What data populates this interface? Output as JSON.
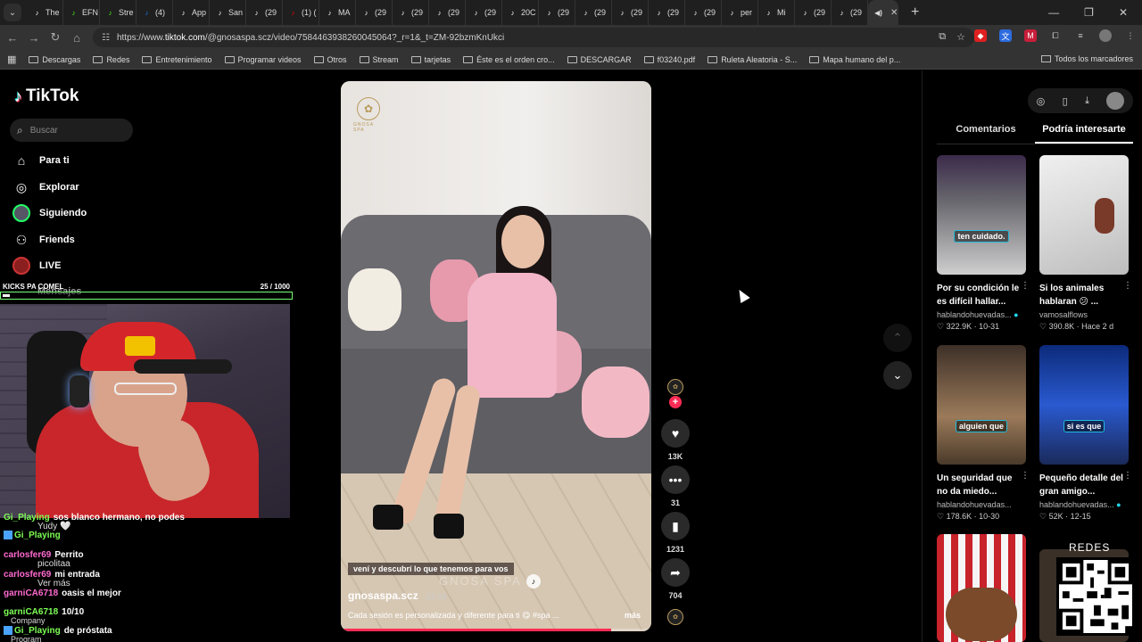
{
  "browser": {
    "tabs": [
      "The",
      "EFN",
      "Stre",
      "(4) ",
      "App",
      "San",
      "(29",
      "(1) (",
      "MA",
      "(29",
      "(29",
      "(29",
      "(29",
      "20C",
      "(29",
      "(29",
      "(29",
      "(29",
      "(29",
      "per",
      "Mi",
      "(29",
      "(29"
    ],
    "url_prefix": "https://www.",
    "url_host": "tiktok.com",
    "url_path": "/@gnosaspa.scz/video/7584463938260045064?_r=1&_t=ZM-92bzmKnUkci",
    "bookmarks": [
      "Descargas",
      "Redes",
      "Entretenimiento",
      "Programar videos",
      "Otros",
      "Stream",
      "tarjetas",
      "Éste es el orden cro...",
      "DESCARGAR",
      "f03240.pdf",
      "Ruleta Aleatoria - S...",
      "Mapa humano del p..."
    ],
    "all_bookmarks": "Todos los marcadores"
  },
  "sidebar": {
    "logo": "TikTok",
    "search_placeholder": "Buscar",
    "items": [
      {
        "label": "Para ti"
      },
      {
        "label": "Explorar"
      },
      {
        "label": "Siguiendo"
      },
      {
        "label": "Friends"
      },
      {
        "label": "LIVE"
      },
      {
        "label": "Mensajes"
      }
    ]
  },
  "overlay": {
    "kick_label": "KICKS PA COMEL",
    "kick_count": "25  / 1000",
    "kick_progress": 0.025,
    "chat": [
      {
        "user": "Gi_Playing",
        "msg": "sos blanco hermano, no podes",
        "color": "green"
      },
      {
        "user": "Gi_Playing",
        "msg": "",
        "color": "green"
      },
      {
        "user": "carlosfer69",
        "msg": "Perrito",
        "color": "pink"
      },
      {
        "user": "carlosfer69",
        "msg": "mi entrada",
        "color": "pink"
      },
      {
        "user": "garniCA6718",
        "msg": "oasis el mejor",
        "color": "pink"
      },
      {
        "user": "garniCA6718",
        "msg": "10/10",
        "color": "green"
      },
      {
        "user": "Gi_Playing",
        "msg": "de próstata",
        "color": "green"
      }
    ],
    "ghost_texts": [
      "Yudy 🤍",
      "picolitaa",
      "Ver más",
      "Company",
      "Program"
    ]
  },
  "video": {
    "brand": "GNOSA SPA",
    "caption_overlay": "vení y descubrí lo que tenemos para vos",
    "watermark": "GNOSA SPA",
    "author": "gnosaspa.scz",
    "date": "· 12-16",
    "description": "Cada sesión es personalizada y diferente para ti 😋 #spa ...",
    "more": "más",
    "progress": 0.87
  },
  "actions": {
    "likes": "13K",
    "comments": "31",
    "saves": "1231",
    "shares": "704"
  },
  "right_panel": {
    "tabs": [
      "Comentarios",
      "Podría interesarte"
    ],
    "cards": [
      {
        "caption": "ten cuidado.",
        "title": "Por su condición le es difícil hallar...",
        "author": "hablandohuevadas...",
        "likes": "322.9K",
        "date": "10-31",
        "verified": true
      },
      {
        "caption": "",
        "title": "Si los animales hablaran 😕 ...",
        "author": "vamosalflows",
        "likes": "390.8K",
        "date": "Hace 2 d",
        "verified": false
      },
      {
        "caption": "alguien que",
        "title": "Un seguridad que no da miedo...",
        "author": "hablandohuevadas...",
        "likes": "178.6K",
        "date": "10-30",
        "verified": false
      },
      {
        "caption": "si es que",
        "title": "Pequeño detalle del gran amigo...",
        "author": "hablandohuevadas...",
        "likes": "52K",
        "date": "12-15",
        "verified": true
      }
    ],
    "qr_label": "REDES"
  }
}
